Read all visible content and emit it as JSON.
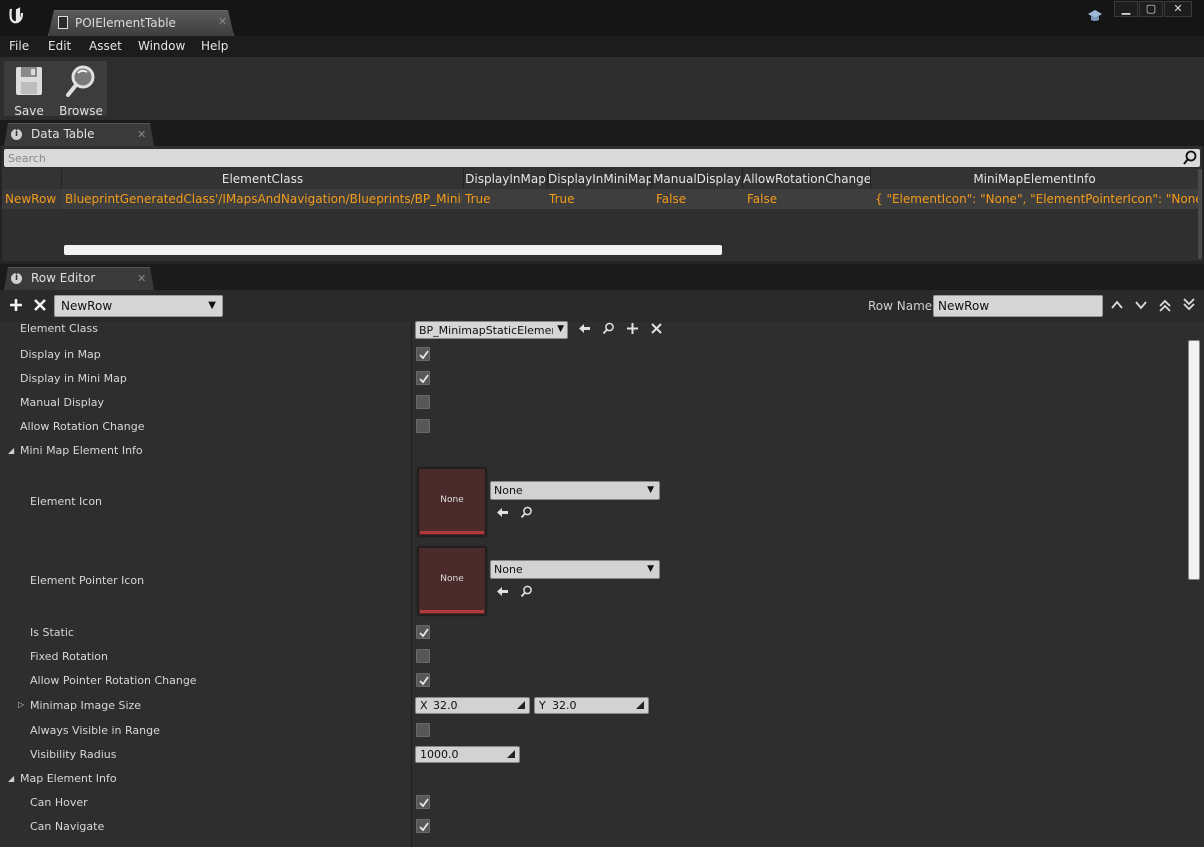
{
  "window": {
    "document_tab": "POIElementTable"
  },
  "menu": [
    "File",
    "Edit",
    "Asset",
    "Window",
    "Help"
  ],
  "toolbar": {
    "save_label": "Save",
    "browse_label": "Browse"
  },
  "data_table_panel": {
    "tab_label": "Data Table",
    "search_placeholder": "Search",
    "columns": [
      "ElementClass",
      "DisplayInMap",
      "DisplayInMiniMap",
      "ManualDisplay",
      "AllowRotationChange",
      "MiniMapElementInfo"
    ],
    "row": {
      "name": "NewRow",
      "cells": [
        "BlueprintGeneratedClass'/IMapsAndNavigation/Blueprints/BP_MinimapStaticElement",
        "True",
        "True",
        "False",
        "False",
        "{ \"ElementIcon\": \"None\", \"ElementPointerIcon\": \"None\", \"IsStatic\""
      ]
    }
  },
  "row_editor": {
    "tab_label": "Row Editor",
    "selected_row": "NewRow",
    "row_name_label": "Row Name:",
    "row_name_value": "NewRow",
    "properties": {
      "element_class": {
        "label": "Element Class",
        "value": "BP_MinimapStaticElement"
      },
      "display_in_map": {
        "label": "Display in Map",
        "checked": true
      },
      "display_in_mini_map": {
        "label": "Display in Mini Map",
        "checked": true
      },
      "manual_display": {
        "label": "Manual Display",
        "checked": false
      },
      "allow_rotation_change": {
        "label": "Allow Rotation Change",
        "checked": false
      },
      "mini_map_element_info": {
        "label": "Mini Map Element Info"
      },
      "element_icon": {
        "label": "Element Icon",
        "thumb": "None",
        "value": "None"
      },
      "element_pointer_icon": {
        "label": "Element Pointer Icon",
        "thumb": "None",
        "value": "None"
      },
      "is_static": {
        "label": "Is Static",
        "checked": true
      },
      "fixed_rotation": {
        "label": "Fixed Rotation",
        "checked": false
      },
      "allow_pointer_rotation_change": {
        "label": "Allow Pointer Rotation Change",
        "checked": true
      },
      "minimap_image_size": {
        "label": "Minimap Image Size",
        "x_label": "X",
        "x": "32.0",
        "y_label": "Y",
        "y": "32.0"
      },
      "always_visible_in_range": {
        "label": "Always Visible in Range",
        "checked": false
      },
      "visibility_radius": {
        "label": "Visibility Radius",
        "value": "1000.0"
      },
      "map_element_info": {
        "label": "Map Element Info"
      },
      "can_hover": {
        "label": "Can Hover",
        "checked": true
      },
      "can_navigate": {
        "label": "Can Navigate",
        "checked": true
      }
    }
  },
  "colors": {
    "row_text": "#f39c1a",
    "background": "#2e2e2e"
  }
}
